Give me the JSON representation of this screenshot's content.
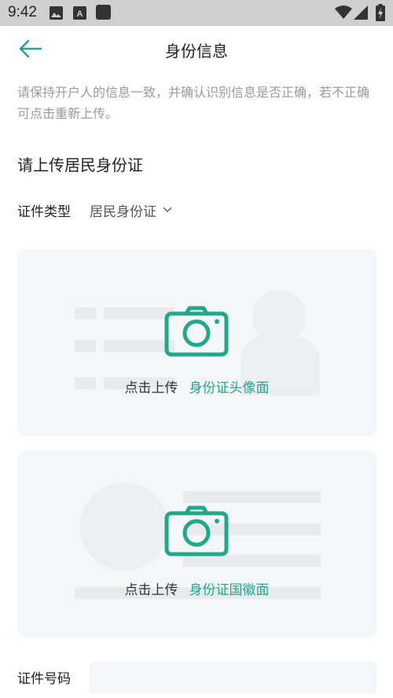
{
  "status_bar": {
    "time": "9:42",
    "icons": [
      "photo-icon",
      "a-notification-icon",
      "square-icon",
      "wifi-icon",
      "signal-icon",
      "battery-icon"
    ]
  },
  "header": {
    "title": "身份信息",
    "back_icon": "back-arrow-icon"
  },
  "notice": "请保持开户人的信息一致，并确认识别信息是否正确，若不正确可点击重新上传。",
  "section_title": "请上传居民身份证",
  "doc_type": {
    "label": "证件类型",
    "value": "居民身份证"
  },
  "uploads": {
    "front": {
      "prefix": "点击上传",
      "side": "身份证头像面"
    },
    "back": {
      "prefix": "点击上传",
      "side": "身份证国徽面"
    }
  },
  "id_number": {
    "label": "证件号码",
    "value": "",
    "placeholder": ""
  },
  "colors": {
    "accent": "#1fa88a",
    "card_bg": "#f5f6f8",
    "status_bar": "#cfcfcf"
  }
}
